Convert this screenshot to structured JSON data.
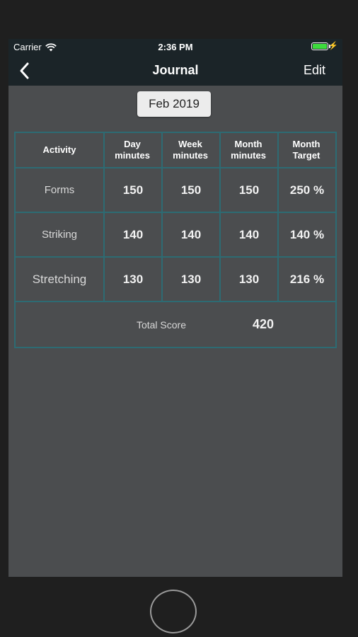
{
  "status": {
    "carrier": "Carrier",
    "time": "2:36 PM",
    "battery_level": 1.0
  },
  "nav": {
    "title": "Journal",
    "edit_label": "Edit"
  },
  "month": "Feb 2019",
  "table": {
    "headers": [
      "Activity",
      "Day minutes",
      "Week minutes",
      "Month minutes",
      "Month Target"
    ],
    "rows": [
      {
        "activity": "Forms",
        "day": "150",
        "week": "150",
        "month": "150",
        "target": "250 %"
      },
      {
        "activity": "Striking",
        "day": "140",
        "week": "140",
        "month": "140",
        "target": "140 %"
      },
      {
        "activity": "Stretching",
        "day": "130",
        "week": "130",
        "month": "130",
        "target": "216 %"
      }
    ],
    "total_label": "Total Score",
    "total_value": "420"
  },
  "colors": {
    "nav_bg": "#1b2428",
    "screen_bg": "#4b4d4f",
    "grid": "#2d6b73",
    "battery": "#3ddc3d"
  }
}
